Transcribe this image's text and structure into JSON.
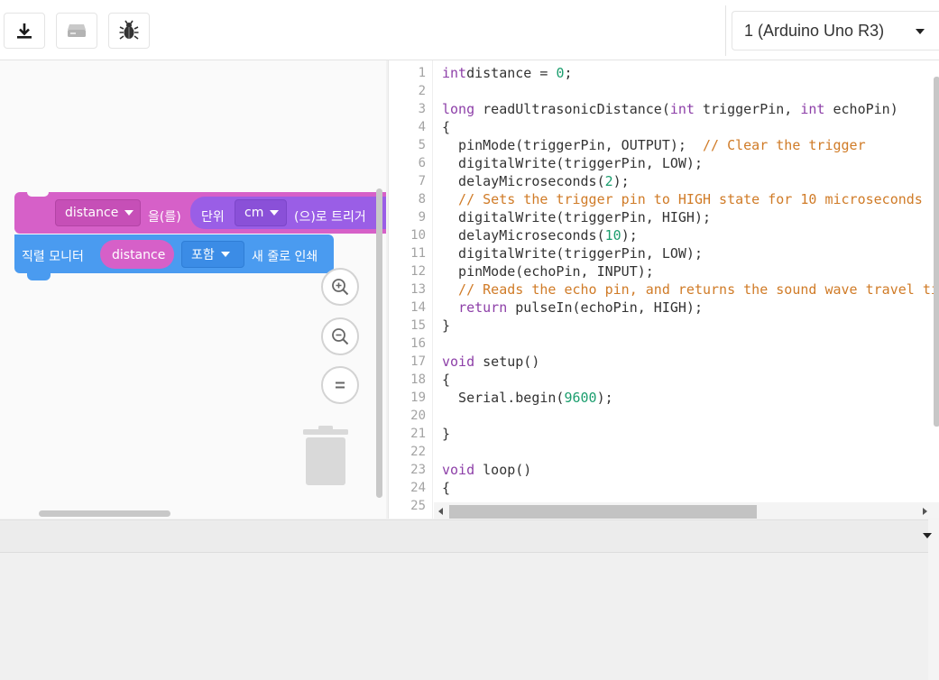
{
  "toolbar": {
    "download_icon": "download-icon",
    "upload_icon": "upload-drive-icon",
    "debug_icon": "bug-icon",
    "board_select": "1 (Arduino Uno R3)"
  },
  "blocks": {
    "write_var": "distance",
    "write_obj": "을(를)",
    "unit_label": "단위",
    "unit_value": "cm",
    "unit_suffix": "(으)로 트리거 ",
    "print_label": "직렬 모니터",
    "print_var": "distance",
    "newline_option": "포함",
    "newline_label": "새 줄로 인쇄"
  },
  "code": [
    {
      "n": "1",
      "parts": [
        [
          "kw",
          "int"
        ],
        [
          "",
          "distance = "
        ],
        [
          "num",
          "0"
        ],
        [
          "",
          ";"
        ]
      ]
    },
    {
      "n": "2",
      "parts": []
    },
    {
      "n": "3",
      "parts": [
        [
          "kw",
          "long"
        ],
        [
          "",
          " readUltrasonicDistance("
        ],
        [
          "kw",
          "int"
        ],
        [
          "",
          " triggerPin, "
        ],
        [
          "kw",
          "int"
        ],
        [
          "",
          " echoPin)"
        ]
      ]
    },
    {
      "n": "4",
      "parts": [
        [
          "",
          "{"
        ]
      ]
    },
    {
      "n": "5",
      "parts": [
        [
          "",
          "  pinMode(triggerPin, OUTPUT);  "
        ],
        [
          "cm",
          "// Clear the trigger"
        ]
      ]
    },
    {
      "n": "6",
      "parts": [
        [
          "",
          "  digitalWrite(triggerPin, LOW);"
        ]
      ]
    },
    {
      "n": "7",
      "parts": [
        [
          "",
          "  delayMicroseconds("
        ],
        [
          "num",
          "2"
        ],
        [
          "",
          ");"
        ]
      ]
    },
    {
      "n": "8",
      "parts": [
        [
          "cm",
          "  // Sets the trigger pin to HIGH state for 10 microseconds"
        ]
      ]
    },
    {
      "n": "9",
      "parts": [
        [
          "",
          "  digitalWrite(triggerPin, HIGH);"
        ]
      ]
    },
    {
      "n": "10",
      "parts": [
        [
          "",
          "  delayMicroseconds("
        ],
        [
          "num",
          "10"
        ],
        [
          "",
          ");"
        ]
      ]
    },
    {
      "n": "11",
      "parts": [
        [
          "",
          "  digitalWrite(triggerPin, LOW);"
        ]
      ]
    },
    {
      "n": "12",
      "parts": [
        [
          "",
          "  pinMode(echoPin, INPUT);"
        ]
      ]
    },
    {
      "n": "13",
      "parts": [
        [
          "cm",
          "  // Reads the echo pin, and returns the sound wave travel time"
        ]
      ]
    },
    {
      "n": "14",
      "parts": [
        [
          "",
          "  "
        ],
        [
          "kw",
          "return"
        ],
        [
          "",
          " pulseIn(echoPin, HIGH);"
        ]
      ]
    },
    {
      "n": "15",
      "parts": [
        [
          "",
          "}"
        ]
      ]
    },
    {
      "n": "16",
      "parts": []
    },
    {
      "n": "17",
      "parts": [
        [
          "kw",
          "void"
        ],
        [
          "",
          " setup()"
        ]
      ]
    },
    {
      "n": "18",
      "parts": [
        [
          "",
          "{"
        ]
      ]
    },
    {
      "n": "19",
      "parts": [
        [
          "",
          "  Serial.begin("
        ],
        [
          "num",
          "9600"
        ],
        [
          "",
          ");"
        ]
      ]
    },
    {
      "n": "20",
      "parts": []
    },
    {
      "n": "21",
      "parts": [
        [
          "",
          "}"
        ]
      ]
    },
    {
      "n": "22",
      "parts": []
    },
    {
      "n": "23",
      "parts": [
        [
          "kw",
          "void"
        ],
        [
          "",
          " loop()"
        ]
      ]
    },
    {
      "n": "24",
      "parts": [
        [
          "",
          "{"
        ]
      ]
    },
    {
      "n": "25",
      "parts": []
    }
  ],
  "colors": {
    "keyword": "#8d3fa8",
    "number": "#1c9e6e",
    "comment": "#d07b27",
    "block_output": "#d660c8",
    "block_serial": "#4a9bf0"
  }
}
